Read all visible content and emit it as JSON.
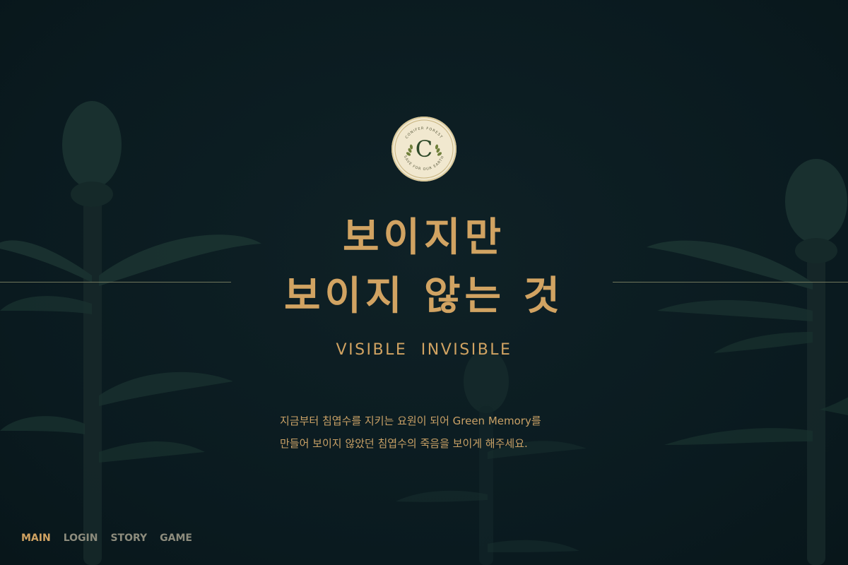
{
  "colors": {
    "background": "#0b1a1f",
    "accent": "#d1a362",
    "nav_inactive": "#8d8c7d",
    "emblem_bg": "#f1e8cf",
    "emblem_letter": "#2f4a2a"
  },
  "emblem": {
    "letter": "C",
    "top_text": "CONIFER FOREST",
    "bottom_text": "SAVE FOR OUR EARTH",
    "icon": "laurel-icon"
  },
  "hero": {
    "title_line1": "보이지만",
    "title_line2": "보이지 않는 것",
    "subtitle": "VISIBLE INVISIBLE",
    "desc_line1": "지금부터 침엽수를 지키는 요원이 되어 Green Memory를",
    "desc_line2": "만들어 보이지 않았던 침엽수의 죽음을 보이게 해주세요."
  },
  "nav": {
    "items": [
      {
        "label": "MAIN",
        "active": true
      },
      {
        "label": "LOGIN",
        "active": false
      },
      {
        "label": "STORY",
        "active": false
      },
      {
        "label": "GAME",
        "active": false
      }
    ]
  }
}
